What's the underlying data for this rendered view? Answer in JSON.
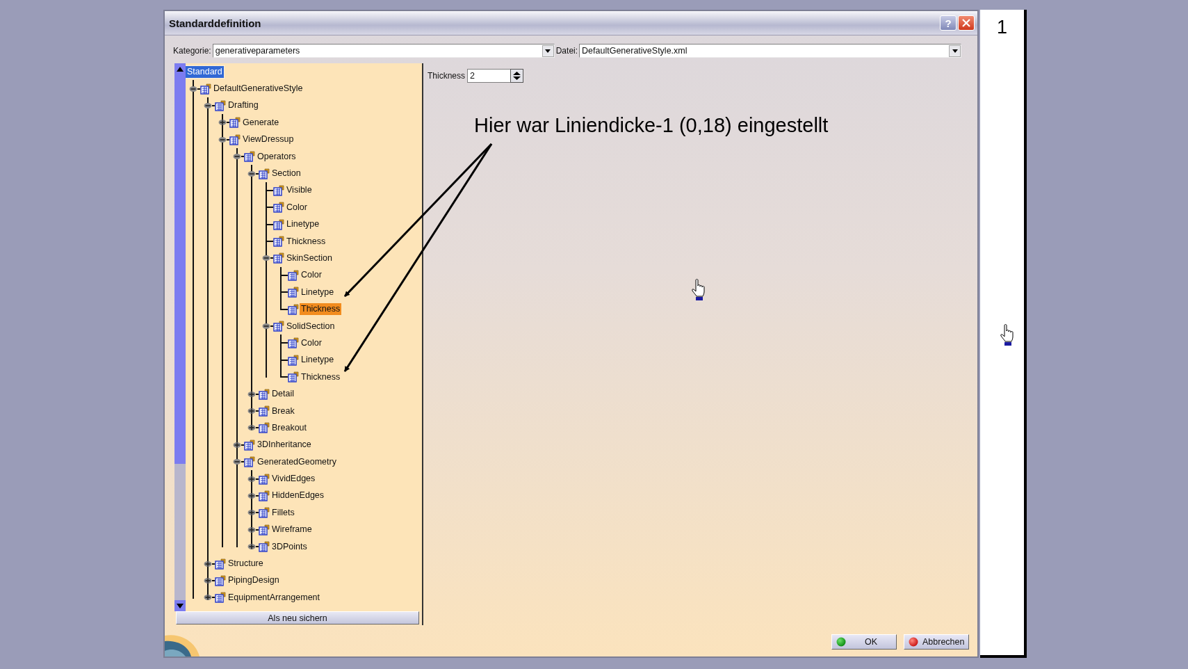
{
  "window": {
    "title": "Standarddefinition",
    "help": "?"
  },
  "category": {
    "label": "Kategorie:",
    "value": "generativeparameters"
  },
  "file": {
    "label": "Datei:",
    "value": "DefaultGenerativeStyle.xml"
  },
  "tree": [
    {
      "label": "Standard",
      "selected": true,
      "children": [
        {
          "label": "DefaultGenerativeStyle",
          "selected": false,
          "expanded": true,
          "children": [
            {
              "label": "Drafting",
              "selected": false,
              "expanded": true,
              "children": [
                {
                  "label": "Generate",
                  "selected": false,
                  "expanded": false
                },
                {
                  "label": "ViewDressup",
                  "selected": false,
                  "expanded": true,
                  "children": [
                    {
                      "label": "Operators",
                      "selected": false,
                      "expanded": true,
                      "children": [
                        {
                          "label": "Section",
                          "selected": false,
                          "expanded": true,
                          "children": [
                            {
                              "label": "Visible",
                              "selected": false
                            },
                            {
                              "label": "Color",
                              "selected": false
                            },
                            {
                              "label": "Linetype",
                              "selected": false
                            },
                            {
                              "label": "Thickness",
                              "selected": false
                            },
                            {
                              "label": "SkinSection",
                              "selected": false,
                              "expanded": true,
                              "children": [
                                {
                                  "label": "Color",
                                  "selected": false
                                },
                                {
                                  "label": "Linetype",
                                  "selected": false
                                },
                                {
                                  "label": "Thickness",
                                  "selected": false,
                                  "highlighted": true
                                }
                              ]
                            },
                            {
                              "label": "SolidSection",
                              "selected": false,
                              "expanded": true,
                              "children": [
                                {
                                  "label": "Color",
                                  "selected": false
                                },
                                {
                                  "label": "Linetype",
                                  "selected": false
                                },
                                {
                                  "label": "Thickness",
                                  "selected": false
                                }
                              ]
                            }
                          ]
                        },
                        {
                          "label": "Detail",
                          "selected": false,
                          "expanded": false
                        },
                        {
                          "label": "Break",
                          "selected": false,
                          "expanded": false
                        },
                        {
                          "label": "Breakout",
                          "selected": false,
                          "expanded": false
                        }
                      ]
                    },
                    {
                      "label": "3DInheritance",
                      "selected": false,
                      "expanded": false
                    },
                    {
                      "label": "GeneratedGeometry",
                      "selected": false,
                      "expanded": true,
                      "children": [
                        {
                          "label": "VividEdges",
                          "selected": false,
                          "expanded": false
                        },
                        {
                          "label": "HiddenEdges",
                          "selected": false,
                          "expanded": false
                        },
                        {
                          "label": "Fillets",
                          "selected": false,
                          "expanded": false
                        },
                        {
                          "label": "Wireframe",
                          "selected": false,
                          "expanded": false
                        },
                        {
                          "label": "3DPoints",
                          "selected": false,
                          "expanded": false
                        }
                      ]
                    }
                  ]
                }
              ]
            },
            {
              "label": "Structure",
              "selected": false,
              "expanded": false
            },
            {
              "label": "PipingDesign",
              "selected": false,
              "expanded": false
            },
            {
              "label": "EquipmentArrangement",
              "selected": false,
              "expanded": false
            }
          ]
        }
      ]
    }
  ],
  "save_button": "Als neu sichern",
  "parameter": {
    "label": "Thickness",
    "value": "2"
  },
  "annotation": "Hier war Liniendicke-1 (0,18) eingestellt",
  "buttons": [
    {
      "label": "OK",
      "kind": "ok"
    },
    {
      "label": "Abbrechen",
      "kind": "cancel"
    }
  ],
  "page_number": "1"
}
